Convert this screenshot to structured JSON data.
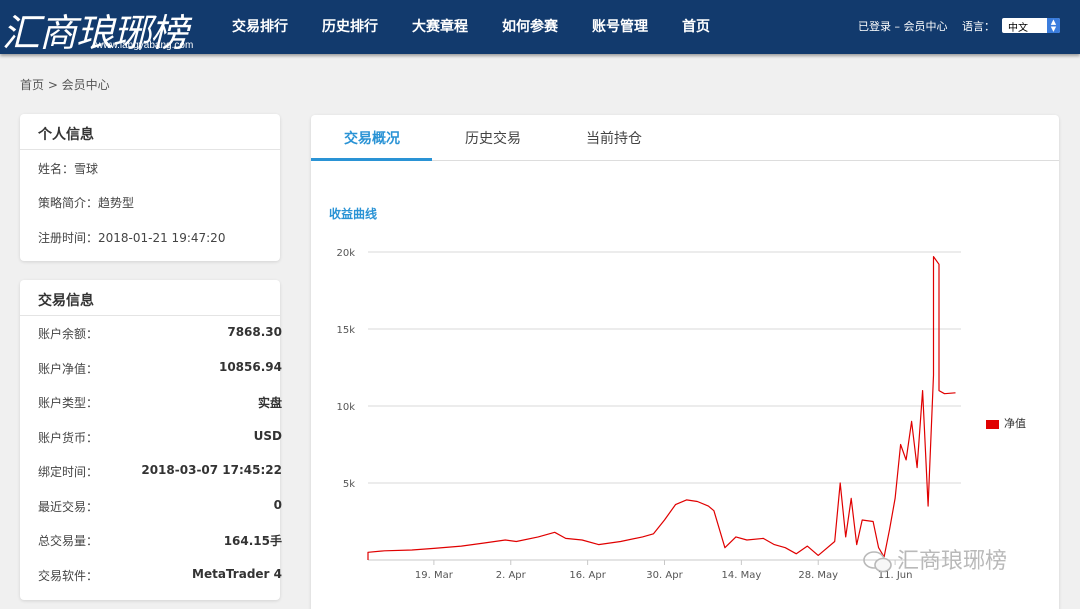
{
  "header": {
    "logo_text": "汇商琅琊榜",
    "logo_url": "www.langyabang.com",
    "nav": [
      "交易排行",
      "历史排行",
      "大赛章程",
      "如何参赛",
      "账号管理",
      "首页"
    ],
    "login_status": "已登录 – 会员中心",
    "language_label": "语言：",
    "language_value": "中文"
  },
  "breadcrumb": "首页 > 会员中心",
  "personal_info": {
    "title": "个人信息",
    "rows": [
      "姓名：雪球",
      "策略简介：趋势型",
      "注册时间：2018-01-21 19:47:20"
    ]
  },
  "trade_info": {
    "title": "交易信息",
    "rows": [
      {
        "label": "账户余额：",
        "value": "7868.30"
      },
      {
        "label": "账户净值：",
        "value": "10856.94"
      },
      {
        "label": "账户类型：",
        "value": "实盘"
      },
      {
        "label": "账户货币：",
        "value": "USD"
      },
      {
        "label": "绑定时间：",
        "value": "2018-03-07 17:45:22"
      },
      {
        "label": "最近交易：",
        "value": "0"
      },
      {
        "label": "总交易量：",
        "value": "164.15手"
      },
      {
        "label": "交易软件：",
        "value": "MetaTrader 4"
      }
    ]
  },
  "tabs": [
    {
      "label": "交易概况",
      "active": true
    },
    {
      "label": "历史交易",
      "active": false
    },
    {
      "label": "当前持仓",
      "active": false
    }
  ],
  "chart_title": "收益曲线",
  "watermark": "汇商琅琊榜",
  "colors": {
    "header": "#123a6d",
    "accent": "#2a93d5",
    "series": "#e00000"
  },
  "chart_data": {
    "type": "line",
    "title": "收益曲线",
    "ylim": [
      0,
      20000
    ],
    "yticks": [
      5000,
      10000,
      15000,
      20000
    ],
    "ytick_labels": [
      "5k",
      "10k",
      "15k",
      "20k"
    ],
    "xticks": [
      "2018-03-19",
      "2018-04-02",
      "2018-04-16",
      "2018-04-30",
      "2018-05-14",
      "2018-05-28",
      "2018-06-11"
    ],
    "xtick_labels": [
      "19. Mar",
      "2. Apr",
      "16. Apr",
      "30. Apr",
      "14. May",
      "28. May",
      "11. Jun"
    ],
    "legend_position": "right",
    "grid": true,
    "series": [
      {
        "name": "净值",
        "color": "#e00000",
        "points": [
          [
            "2018-03-07",
            0
          ],
          [
            "2018-03-07",
            500
          ],
          [
            "2018-03-10",
            600
          ],
          [
            "2018-03-15",
            650
          ],
          [
            "2018-03-19",
            750
          ],
          [
            "2018-03-24",
            900
          ],
          [
            "2018-03-28",
            1100
          ],
          [
            "2018-04-01",
            1300
          ],
          [
            "2018-04-03",
            1200
          ],
          [
            "2018-04-07",
            1500
          ],
          [
            "2018-04-10",
            1800
          ],
          [
            "2018-04-12",
            1400
          ],
          [
            "2018-04-15",
            1300
          ],
          [
            "2018-04-18",
            1000
          ],
          [
            "2018-04-22",
            1200
          ],
          [
            "2018-04-26",
            1500
          ],
          [
            "2018-04-28",
            1700
          ],
          [
            "2018-04-30",
            2600
          ],
          [
            "2018-05-02",
            3600
          ],
          [
            "2018-05-04",
            3900
          ],
          [
            "2018-05-06",
            3800
          ],
          [
            "2018-05-08",
            3500
          ],
          [
            "2018-05-09",
            3200
          ],
          [
            "2018-05-11",
            800
          ],
          [
            "2018-05-13",
            1500
          ],
          [
            "2018-05-15",
            1300
          ],
          [
            "2018-05-18",
            1400
          ],
          [
            "2018-05-20",
            1000
          ],
          [
            "2018-05-22",
            800
          ],
          [
            "2018-05-24",
            400
          ],
          [
            "2018-05-26",
            900
          ],
          [
            "2018-05-28",
            300
          ],
          [
            "2018-05-29",
            600
          ],
          [
            "2018-05-31",
            1200
          ],
          [
            "2018-06-01",
            5000
          ],
          [
            "2018-06-02",
            1500
          ],
          [
            "2018-06-03",
            4000
          ],
          [
            "2018-06-04",
            1000
          ],
          [
            "2018-06-05",
            2600
          ],
          [
            "2018-06-07",
            2500
          ],
          [
            "2018-06-08",
            800
          ],
          [
            "2018-06-09",
            200
          ],
          [
            "2018-06-10",
            2000
          ],
          [
            "2018-06-11",
            4000
          ],
          [
            "2018-06-12",
            7500
          ],
          [
            "2018-06-13",
            6500
          ],
          [
            "2018-06-14",
            9000
          ],
          [
            "2018-06-15",
            6000
          ],
          [
            "2018-06-16",
            11000
          ],
          [
            "2018-06-17",
            3500
          ],
          [
            "2018-06-18",
            12000
          ],
          [
            "2018-06-18",
            19700
          ],
          [
            "2018-06-19",
            19200
          ],
          [
            "2018-06-19",
            11000
          ],
          [
            "2018-06-20",
            10800
          ],
          [
            "2018-06-22",
            10856
          ]
        ]
      }
    ]
  }
}
